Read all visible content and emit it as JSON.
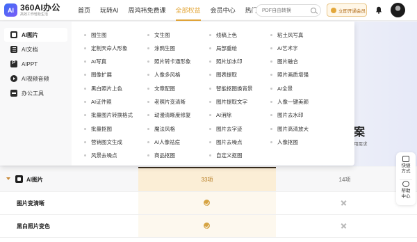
{
  "brand": {
    "icon_text": "AI",
    "name": "360AI办公",
    "tagline": "高效工作轻松生活"
  },
  "nav": {
    "items": [
      {
        "label": "首页"
      },
      {
        "label": "玩转AI"
      },
      {
        "label": "周鸿祎免费课"
      },
      {
        "label": "全部权益",
        "active": true
      },
      {
        "label": "会员中心"
      },
      {
        "label": "热门应用"
      }
    ],
    "active_color": "#e3a73a"
  },
  "search": {
    "placeholder": "PDF自由转换",
    "icon": "search-icon"
  },
  "header_actions": {
    "vip_button_label": "立即开通会员",
    "bell_icon": "bell-icon",
    "avatar_icon": "avatar"
  },
  "dropdown": {
    "categories": [
      {
        "label": "AI图片",
        "icon": "image-icon",
        "active": true
      },
      {
        "label": "AI文档",
        "icon": "document-icon"
      },
      {
        "label": "AIPPT",
        "icon": "ppt-icon"
      },
      {
        "label": "AI视频音频",
        "icon": "video-icon"
      },
      {
        "label": "办公工具",
        "icon": "toolbox-icon"
      }
    ],
    "tools": [
      [
        "图生图",
        "文生图",
        "线稿上色",
        "粘土风写真"
      ],
      [
        "定制天命人形象",
        "涂鸦生图",
        "局部重绘",
        "AI艺术字"
      ],
      [
        "AI写真",
        "照片转卡通形象",
        "照片加水印",
        "图片融合"
      ],
      [
        "图像扩展",
        "人像多风格",
        "图表提取",
        "照片画质增强"
      ],
      [
        "黑白照片上色",
        "文章配图",
        "智能抠图换背景",
        "AI全景"
      ],
      [
        "AI证件照",
        "老照片变清晰",
        "图片提取文字",
        "人像一键美颜"
      ],
      [
        "批量图片转换格式",
        "动漫清晰度修复",
        "AI消除",
        "图片去水印"
      ],
      [
        "批量抠图",
        "魔法风格",
        "图片去字迹",
        "图片高清放大"
      ],
      [
        "营销图文生成",
        "AI人像祛痘",
        "图片去噪点",
        "人像抠图"
      ],
      [
        "风景去噪点",
        "商品抠图",
        "自定义抠图"
      ]
    ]
  },
  "background": {
    "hero_title": "案",
    "hero_subtitle": "用需求"
  },
  "compare_table": {
    "header": {
      "label": "AI图片",
      "vip_count": "33项",
      "free_count": "14项"
    },
    "rows": [
      {
        "label": "图片变清晰",
        "vip": "check",
        "free": "cross"
      },
      {
        "label": "黑白照片变色",
        "vip": "check",
        "free": "cross"
      }
    ],
    "vip_accent": "#d6a443"
  },
  "float_panel": {
    "items": [
      {
        "label": "快捷方式",
        "icon": "shortcut-icon"
      },
      {
        "label": "帮助中心",
        "icon": "help-icon"
      }
    ]
  }
}
